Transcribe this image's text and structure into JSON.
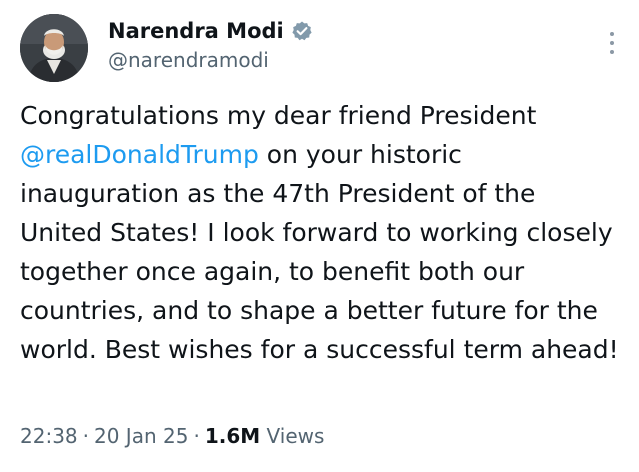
{
  "author": {
    "display_name": "Narendra Modi",
    "handle": "@narendramodi",
    "verified": true,
    "verified_badge_color": "#829aab"
  },
  "tweet": {
    "text_before_mention": "Congratulations my dear friend President",
    "mention": "@realDonaldTrump",
    "text_after_mention": " on your historic inauguration as the 47th President of the United States! I look forward to working closely together once again, to benefit both our countries, and to shape a better future for the world. Best wishes for a successful term ahead!"
  },
  "meta": {
    "time": "22:38",
    "date": "20 Jan 25",
    "separator": "·",
    "views_count": "1.6M",
    "views_label": "Views"
  },
  "icons": {
    "verified": "verified-badge-icon",
    "more": "more-options-icon"
  },
  "colors": {
    "link": "#1d9bf0",
    "text": "#0f1419",
    "secondary": "#536471"
  }
}
